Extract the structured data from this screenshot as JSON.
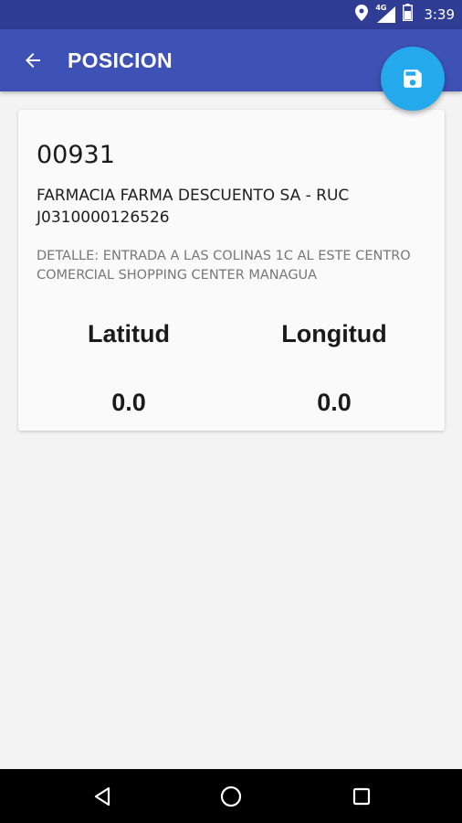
{
  "status_bar": {
    "time": "3:39",
    "network_label": "4G",
    "icons": [
      "location-icon",
      "signal-icon",
      "battery-icon"
    ]
  },
  "app_bar": {
    "title": "POSICION",
    "back_icon": "arrow-left-icon",
    "color": "#3e51b5"
  },
  "fab": {
    "icon": "save-icon",
    "color": "#25a9ed"
  },
  "card": {
    "code": "00931",
    "name": "FARMACIA FARMA DESCUENTO SA - RUC J0310000126526",
    "detail": "DETALLE: ENTRADA A LAS COLINAS 1C AL ESTE CENTRO COMERCIAL SHOPPING CENTER MANAGUA",
    "latitude_label": "Latitud",
    "longitude_label": "Longitud",
    "latitude_value": "0.0",
    "longitude_value": "0.0"
  },
  "nav_bar": {
    "icons": [
      "back-triangle-icon",
      "home-circle-icon",
      "recents-square-icon"
    ]
  }
}
